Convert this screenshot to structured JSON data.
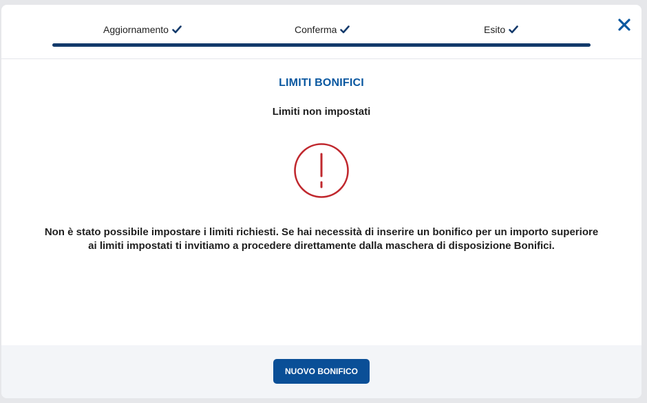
{
  "wizard": {
    "steps": [
      {
        "label": "Aggiornamento",
        "completed": true
      },
      {
        "label": "Conferma",
        "completed": true
      },
      {
        "label": "Esito",
        "completed": true
      }
    ]
  },
  "colors": {
    "brand": "#0a58a0",
    "progress": "#133a6b",
    "error": "#c0282e"
  },
  "icons": {
    "close": "close-icon",
    "step_check": "check-icon",
    "status": "exclamation-circle-icon"
  },
  "content": {
    "title": "LIMITI BONIFICI",
    "subtitle": "Limiti non impostati",
    "message": "Non è stato possibile impostare i limiti richiesti. Se hai necessità di inserire un bonifico per un importo superiore ai limiti impostati ti invitiamo a procedere direttamente dalla maschera di disposizione Bonifici."
  },
  "footer": {
    "primary_button_label": "NUOVO BONIFICO"
  }
}
